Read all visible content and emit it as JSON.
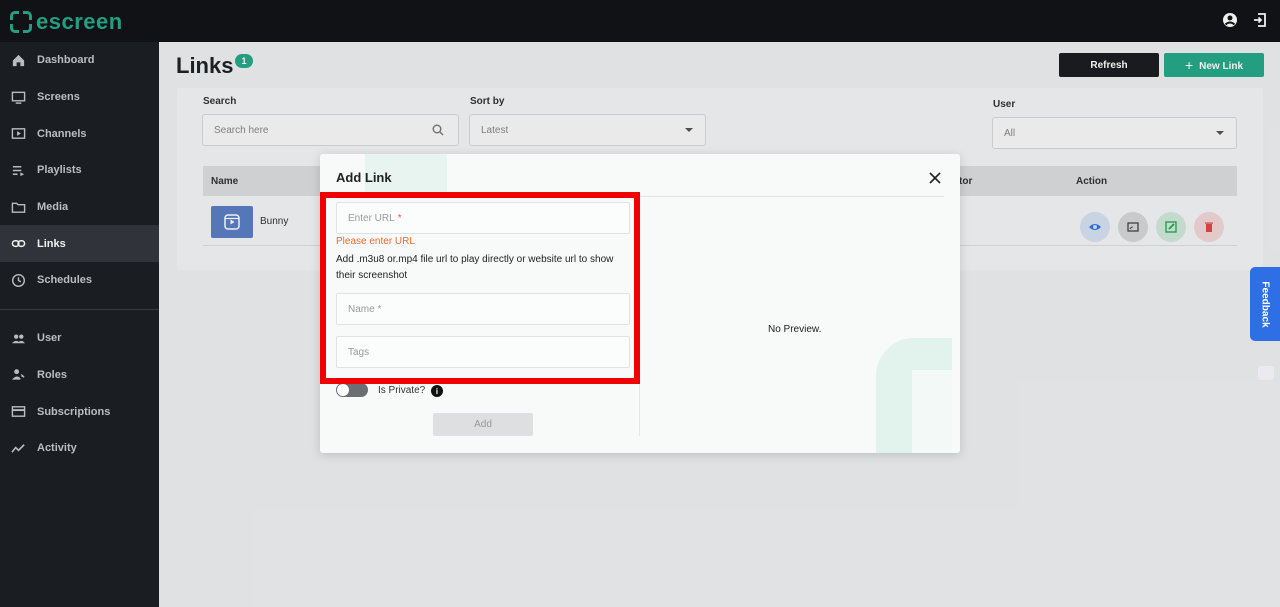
{
  "app": {
    "logo_text": "escreen"
  },
  "topbar": {
    "icons": [
      "account-icon",
      "logout-icon"
    ]
  },
  "sidebar": {
    "items": [
      {
        "label": "Dashboard",
        "icon": "home-icon"
      },
      {
        "label": "Screens",
        "icon": "monitor-icon"
      },
      {
        "label": "Channels",
        "icon": "play-icon"
      },
      {
        "label": "Playlists",
        "icon": "playlist-icon"
      },
      {
        "label": "Media",
        "icon": "folder-icon"
      },
      {
        "label": "Links",
        "icon": "link-icon",
        "active": true
      },
      {
        "label": "Schedules",
        "icon": "clock-icon"
      }
    ],
    "items2": [
      {
        "label": "User",
        "icon": "users-icon"
      },
      {
        "label": "Roles",
        "icon": "user-key-icon"
      },
      {
        "label": "Subscriptions",
        "icon": "card-icon"
      },
      {
        "label": "Activity",
        "icon": "activity-icon"
      }
    ]
  },
  "page": {
    "title": "Links",
    "count": "1",
    "refresh_label": "Refresh",
    "new_link_label": "New Link"
  },
  "filters": {
    "search_label": "Search",
    "search_placeholder": "Search here",
    "sort_label": "Sort by",
    "sort_value": "Latest",
    "user_label": "User",
    "user_value": "All"
  },
  "table": {
    "headers": {
      "name": "Name",
      "creator": "tor",
      "action": "Action"
    },
    "rows": [
      {
        "name": "Bunny"
      }
    ]
  },
  "feedback": {
    "label": "Feedback"
  },
  "modal": {
    "title": "Add Link",
    "url_placeholder": "Enter URL",
    "required_mark": "*",
    "url_error": "Please enter URL",
    "url_help": "Add .m3u8 or.mp4 file url to play directly or website url to show their screenshot",
    "name_placeholder": "Name *",
    "tags_placeholder": "Tags",
    "private_label": "Is Private?",
    "info_glyph": "i",
    "add_label": "Add",
    "preview_text": "No Preview."
  },
  "colors": {
    "accent": "#27a889",
    "highlight": "#f00000",
    "feedback": "#2f6fe6"
  }
}
